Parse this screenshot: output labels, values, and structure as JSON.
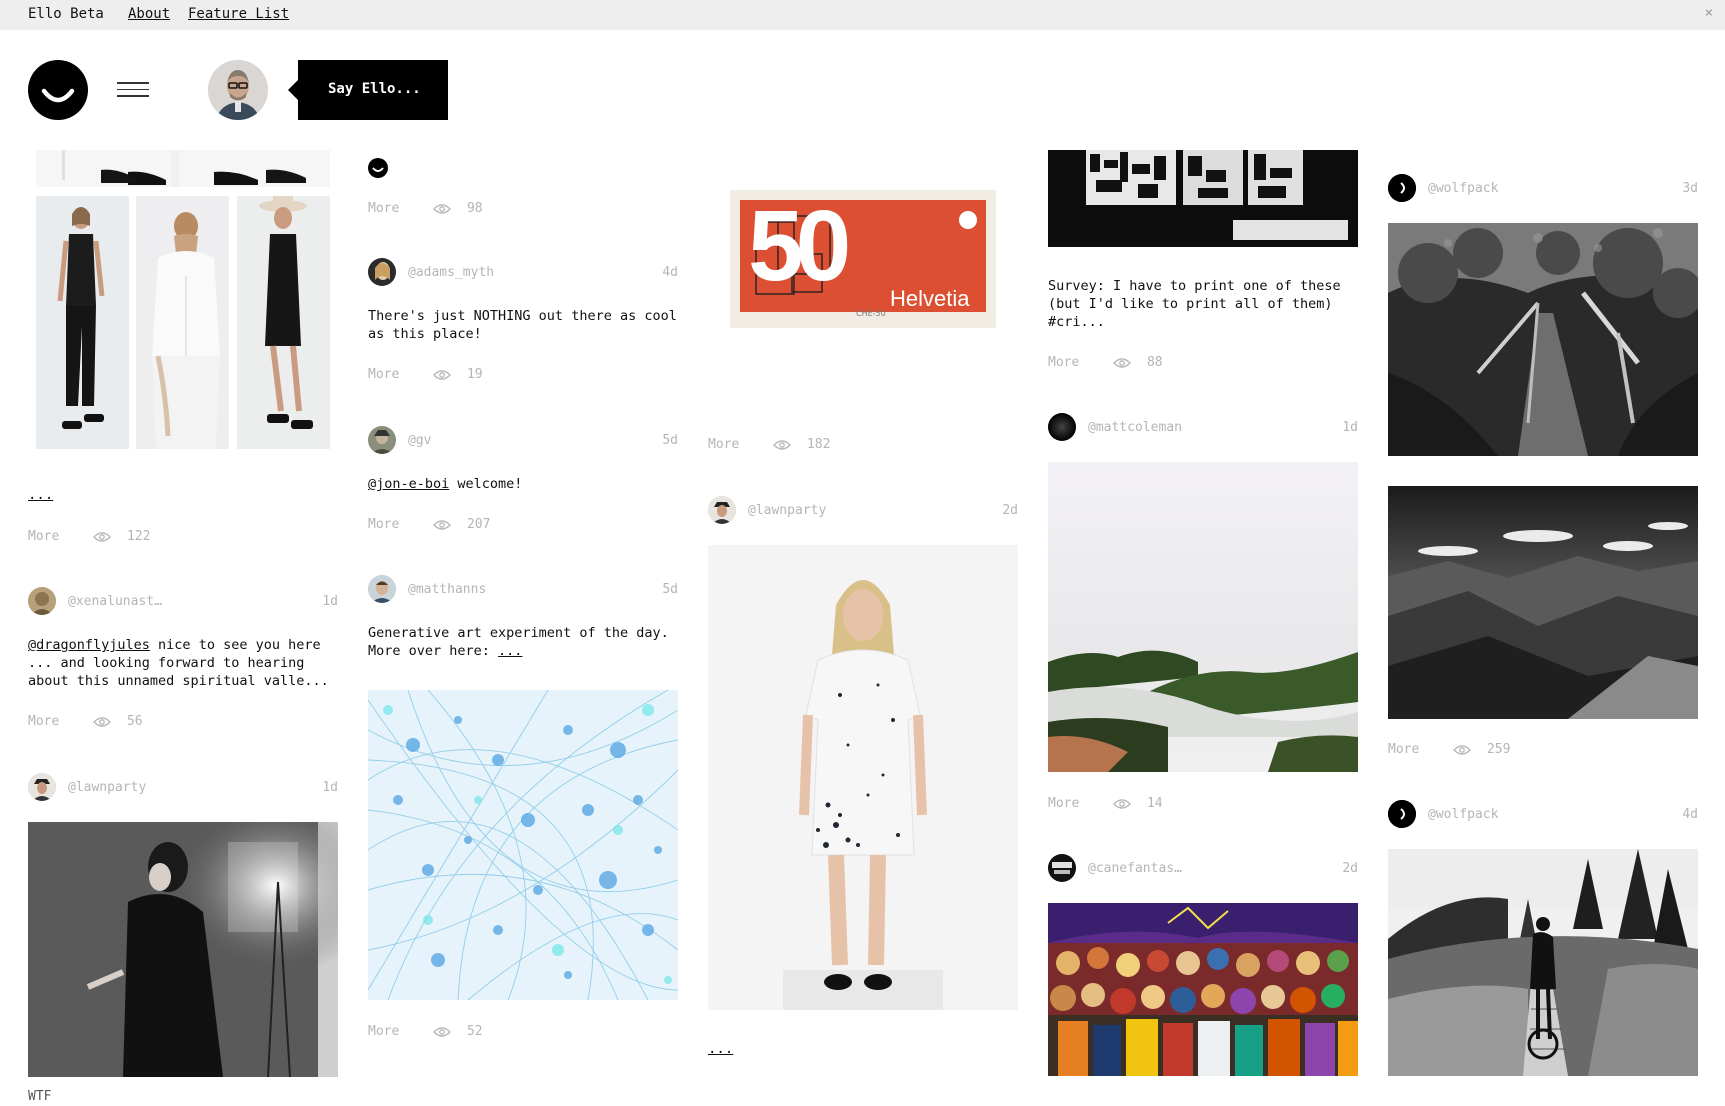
{
  "topbar": {
    "brand": "Ello Beta",
    "about": "About",
    "feature_list": "Feature List",
    "close": "×"
  },
  "compose": {
    "say_ello": "Say Ello..."
  },
  "labels": {
    "more": "More"
  },
  "col1": {
    "p1_dots": "...",
    "p1_views": "122",
    "p2_user": "@xenalunast…",
    "p2_time": "1d",
    "p2_mention": "@dragonflyjules",
    "p2_text": " nice to see you here\n... and looking forward to hearing\nabout this unnamed spiritual valle...",
    "p2_views": "56",
    "p3_user": "@lawnparty",
    "p3_time": "1d",
    "p3_caption": "WTF"
  },
  "col2": {
    "p1_views": "98",
    "p2_user": "@adams_myth",
    "p2_time": "4d",
    "p2_text": "There's just NOTHING out there as cool\nas this place!",
    "p2_views": "19",
    "p3_user": "@gv",
    "p3_time": "5d",
    "p3_mention": "@jon-e-boi",
    "p3_text": " welcome!",
    "p3_views": "207",
    "p4_user": "@matthanns",
    "p4_time": "5d",
    "p4_text": "Generative art experiment of the day.\nMore over here: ",
    "p4_link": "...",
    "p4_views": "52"
  },
  "col3": {
    "stamp_number": "50",
    "stamp_word": "Helvetia",
    "p1_views": "182",
    "p2_user": "@lawnparty",
    "p2_time": "2d",
    "p2_dots": "..."
  },
  "col4": {
    "p1_text": "Survey: I have to print one of these\n(but I'd like to print all of them)\n#cri...",
    "p1_views": "88",
    "p2_user": "@mattcoleman",
    "p2_time": "1d",
    "p2_views": "14",
    "p3_user": "@canefantas…",
    "p3_time": "2d"
  },
  "col5": {
    "p1_user": "@wolfpack",
    "p1_time": "3d",
    "p1_views": "259",
    "p2_user": "@wolfpack",
    "p2_time": "4d"
  }
}
